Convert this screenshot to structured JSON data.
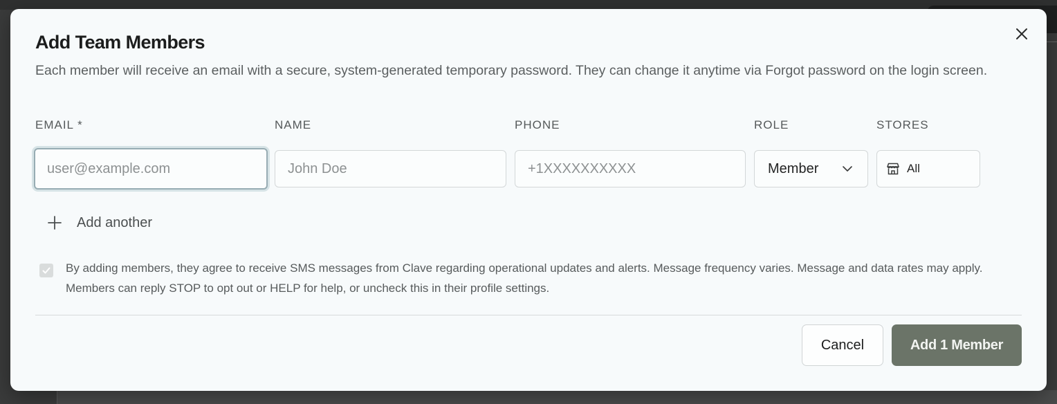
{
  "modal": {
    "title": "Add Team Members",
    "description": "Each member will receive an email with a secure, system-generated temporary password. They can change it anytime via Forgot password on the login screen."
  },
  "columns": {
    "email": "EMAIL *",
    "name": "NAME",
    "phone": "PHONE",
    "role": "ROLE",
    "stores": "STORES"
  },
  "row": {
    "email_placeholder": "user@example.com",
    "name_placeholder": "John Doe",
    "phone_placeholder": "+1XXXXXXXXXX",
    "role_value": "Member",
    "stores_value": "All"
  },
  "add_another_label": "Add another",
  "consent": {
    "checked": true,
    "text": "By adding members, they agree to receive SMS messages from Clave regarding operational updates and alerts. Message frequency varies. Message and data rates may apply. Members can reply STOP to opt out or HELP for help, or uncheck this in their profile settings."
  },
  "footer": {
    "cancel_label": "Cancel",
    "submit_label": "Add 1 Member"
  },
  "icons": {
    "close": "close-icon",
    "chevron": "chevron-down-icon",
    "store": "store-icon",
    "plus": "plus-icon",
    "check": "check-icon"
  },
  "colors": {
    "primary_button": "#6b7468",
    "focus_ring": "#97acb3"
  }
}
